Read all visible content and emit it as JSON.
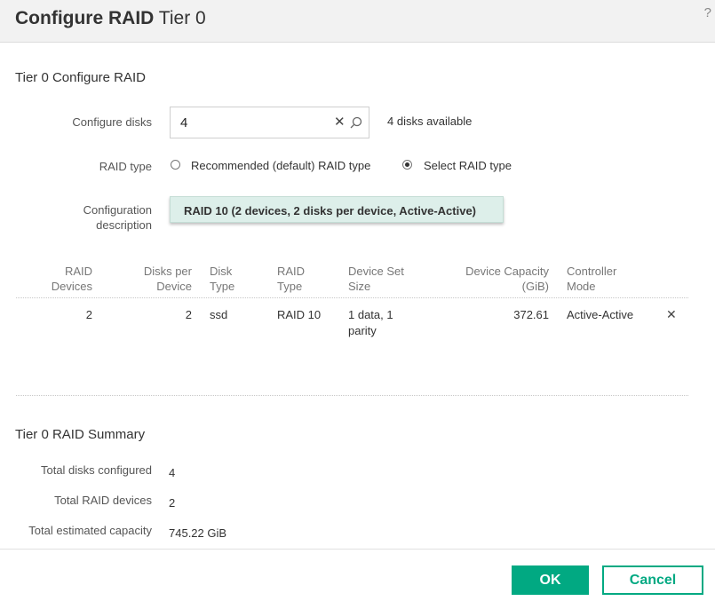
{
  "header": {
    "title_bold": "Configure RAID",
    "title_light": "Tier 0",
    "help_label": "?"
  },
  "configure_section": {
    "title": "Tier 0 Configure RAID",
    "disks_label": "Configure disks",
    "disks_value": "4",
    "disks_available": "4 disks available",
    "raid_type_label": "RAID type",
    "raid_options": [
      {
        "label": "Recommended (default) RAID type",
        "selected": false
      },
      {
        "label": "Select RAID type",
        "selected": true
      }
    ],
    "config_desc_label_line1": "Configuration",
    "config_desc_label_line2": "description",
    "config_desc_value": "RAID 10 (2 devices, 2 disks per device, Active-Active)"
  },
  "table": {
    "headers": {
      "raid_devices": [
        "RAID",
        "Devices"
      ],
      "disks_per_device": [
        "Disks per",
        "Device"
      ],
      "disk_type": [
        "Disk",
        "Type"
      ],
      "raid_type": [
        "RAID",
        "Type"
      ],
      "device_set_size": [
        "Device Set",
        "Size"
      ],
      "device_capacity": [
        "Device Capacity",
        "(GiB)"
      ],
      "controller_mode": [
        "Controller",
        "Mode"
      ]
    },
    "rows": [
      {
        "raid_devices": "2",
        "disks_per_device": "2",
        "disk_type": "ssd",
        "raid_type": "RAID 10",
        "device_set_size_line1": "1 data, 1",
        "device_set_size_line2": "parity",
        "device_capacity": "372.61",
        "controller_mode": "Active-Active",
        "remove_label": "✕"
      }
    ]
  },
  "summary": {
    "title": "Tier 0 RAID Summary",
    "items": [
      {
        "label": "Total disks configured",
        "value": "4"
      },
      {
        "label": "Total RAID devices",
        "value": "2"
      },
      {
        "label": "Total estimated capacity",
        "value": "745.22 GiB"
      }
    ]
  },
  "footer": {
    "ok_label": "OK",
    "cancel_label": "Cancel"
  },
  "icons": {
    "clear": "close-icon",
    "search": "search-icon",
    "help": "help-icon",
    "remove": "close-icon"
  },
  "colors": {
    "accent": "#01a982",
    "selected_bg": "#ddefea",
    "header_bg": "#f2f2f2"
  }
}
